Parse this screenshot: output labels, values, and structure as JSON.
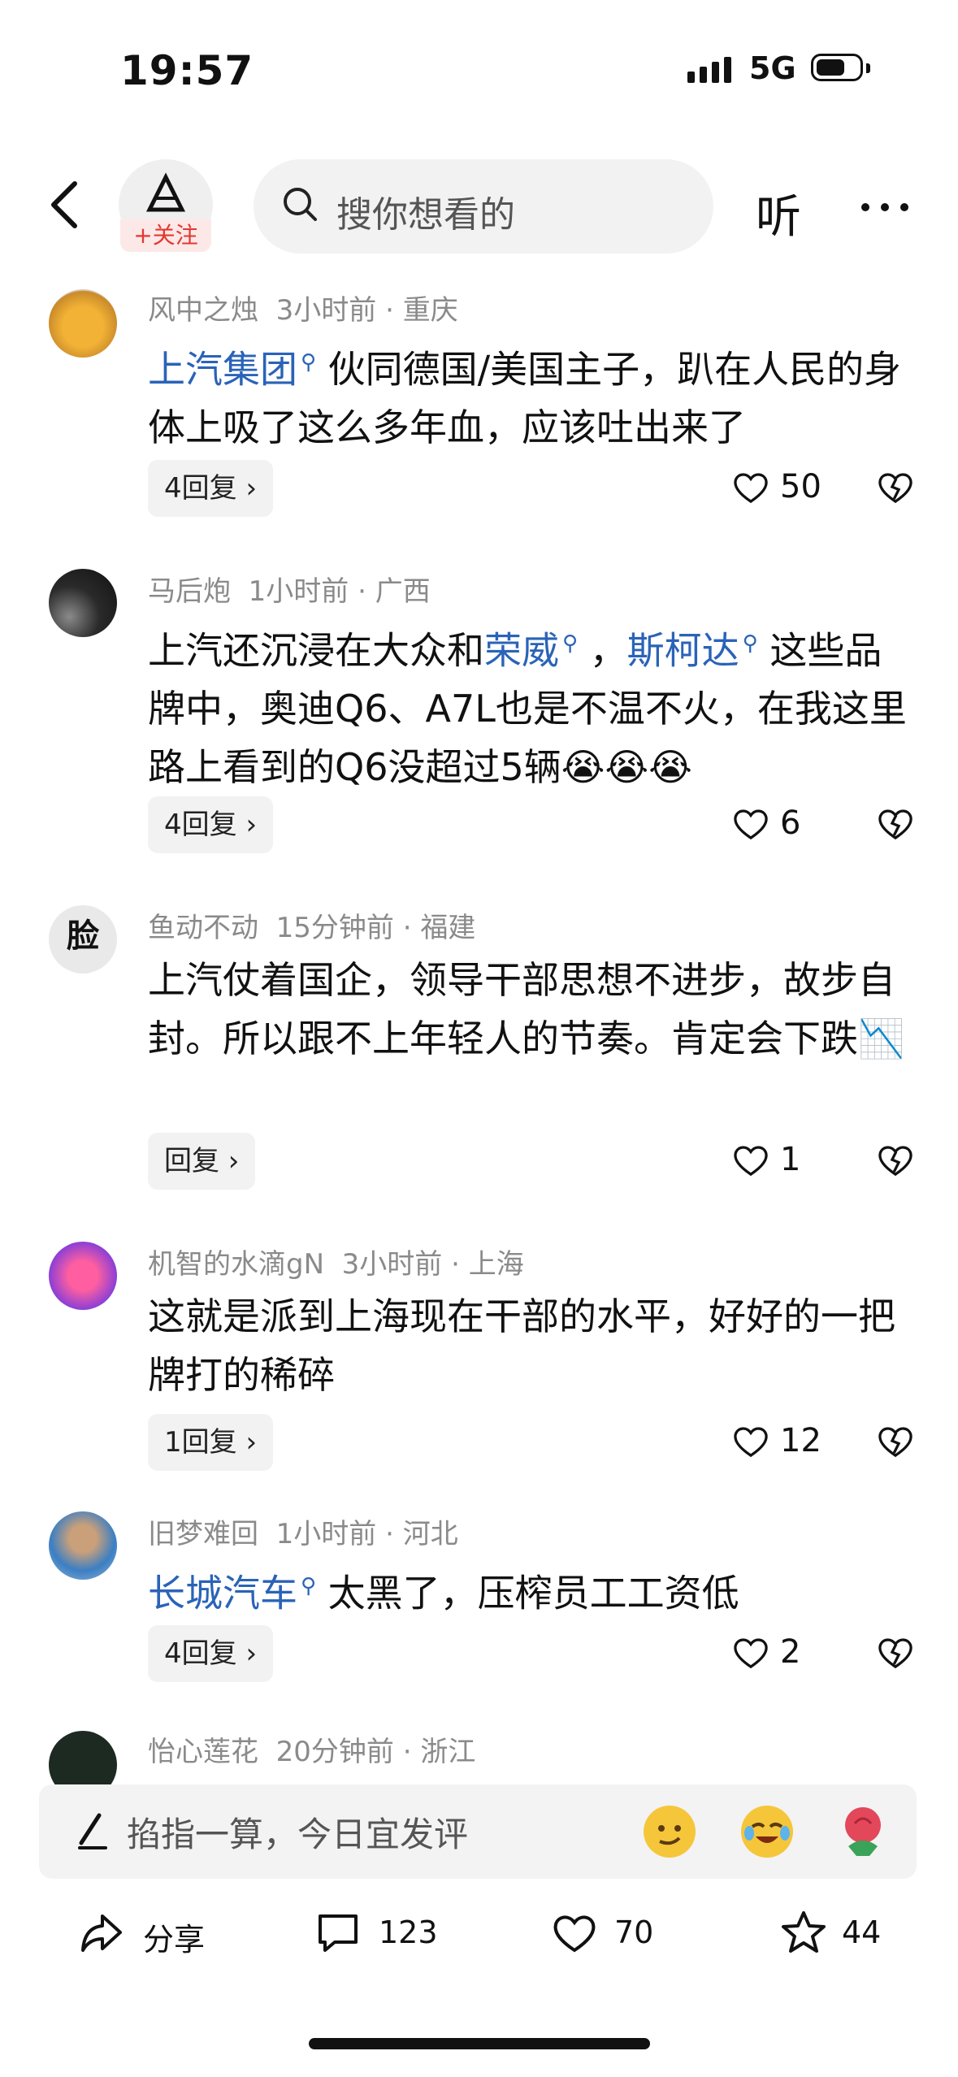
{
  "status": {
    "time": "19:57",
    "network": "5G"
  },
  "nav": {
    "follow_label": "+关注",
    "search_placeholder": "搜你想看的",
    "listen_label": "听"
  },
  "comments": [
    {
      "user": "风中之烛",
      "time": "3小时前",
      "location": "重庆",
      "segments": [
        {
          "text": "上汽集团",
          "link": true
        },
        {
          "text": " 伙同德国/美国主子，趴在人民的身体上吸了这么多年血，应该吐出来了",
          "link": false
        }
      ],
      "reply": "4回复 ›",
      "likes": "50"
    },
    {
      "user": "马后炮",
      "time": "1小时前",
      "location": "广西",
      "segments": [
        {
          "text": "上汽还沉浸在大众和",
          "link": false
        },
        {
          "text": "荣威",
          "link": true
        },
        {
          "text": " ，",
          "link": false
        },
        {
          "text": "斯柯达",
          "link": true
        },
        {
          "text": " 这些品牌中，奥迪Q6、A7L也是不温不火，在我这里路上看到的Q6没超过5辆😭😭😭",
          "link": false
        }
      ],
      "reply": "4回复 ›",
      "likes": "6"
    },
    {
      "user": "鱼动不动",
      "time": "15分钟前",
      "location": "福建",
      "avatar_text": "脸",
      "segments": [
        {
          "text": "上汽仗着国企，领导干部思想不进步，故步自封。所以跟不上年轻人的节奏。肯定会下跌📉",
          "link": false
        }
      ],
      "reply": "回复 ›",
      "likes": "1"
    },
    {
      "user": "机智的水滴gN",
      "time": "3小时前",
      "location": "上海",
      "segments": [
        {
          "text": "这就是派到上海现在干部的水平，好好的一把牌打的稀碎",
          "link": false
        }
      ],
      "reply": "1回复 ›",
      "likes": "12"
    },
    {
      "user": "旧梦难回",
      "time": "1小时前",
      "location": "河北",
      "segments": [
        {
          "text": "长城汽车",
          "link": true
        },
        {
          "text": " 太黑了，压榨员工工资低",
          "link": false
        }
      ],
      "reply": "4回复 ›",
      "likes": "2"
    },
    {
      "user": "怡心莲花",
      "time": "20分钟前",
      "location": "浙江"
    }
  ],
  "input": {
    "placeholder": "掐指一算，今日宜发评"
  },
  "actions": {
    "share": "分享",
    "comments": "123",
    "likes": "70",
    "favorites": "44"
  },
  "colors": {
    "link": "#2a63b8",
    "follow": "#e2392f"
  }
}
